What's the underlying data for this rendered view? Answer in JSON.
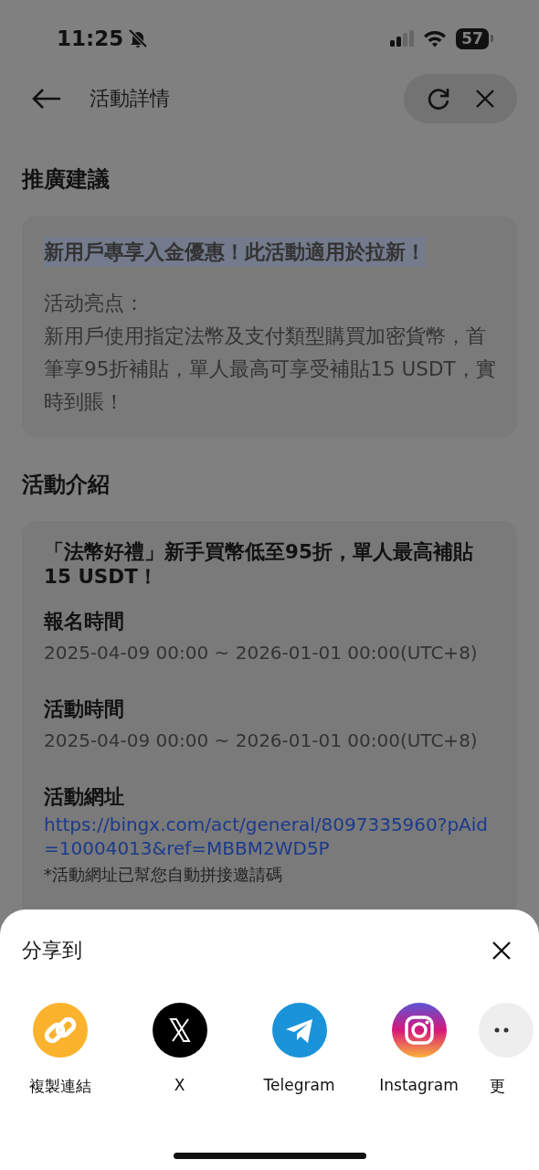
{
  "status_bar": {
    "time": "11:25",
    "silent": true,
    "battery": "57"
  },
  "header": {
    "title": "活動詳情"
  },
  "promo": {
    "heading": "推廣建議",
    "headline": "新用戶專享入金優惠！此活動適用於拉新！",
    "headline_selected": true,
    "highlight_label": "活动亮点：",
    "body": "新用戶使用指定法幣及支付類型購買加密貨幣，首筆享95折補貼，單人最高可享受補貼15 USDT，實時到賬！"
  },
  "intro": {
    "heading": "活動介紹",
    "title": "「法幣好禮」新手買幣低至95折，單人最高補貼15 USDT！",
    "fields": [
      {
        "kind": "text",
        "label": "報名時間",
        "value": "2025-04-09 00:00 ~ 2026-01-01 00:00(UTC+8)"
      },
      {
        "kind": "text",
        "label": "活動時間",
        "value": "2025-04-09 00:00 ~ 2026-01-01 00:00(UTC+8)"
      },
      {
        "kind": "link",
        "label": "活動網址",
        "value": "https://bingx.com/act/general/8097335960?pAid=10004013&ref=MBBM2WD5P",
        "note": "*活動網址已幫您自動拼接邀請碼"
      }
    ]
  },
  "share_sheet": {
    "title": "分享到",
    "targets": [
      {
        "kind": "link",
        "label": "複製連結"
      },
      {
        "kind": "x",
        "label": "X"
      },
      {
        "kind": "telegram",
        "label": "Telegram"
      },
      {
        "kind": "instagram",
        "label": "Instagram"
      },
      {
        "kind": "more",
        "label": "更"
      }
    ]
  }
}
